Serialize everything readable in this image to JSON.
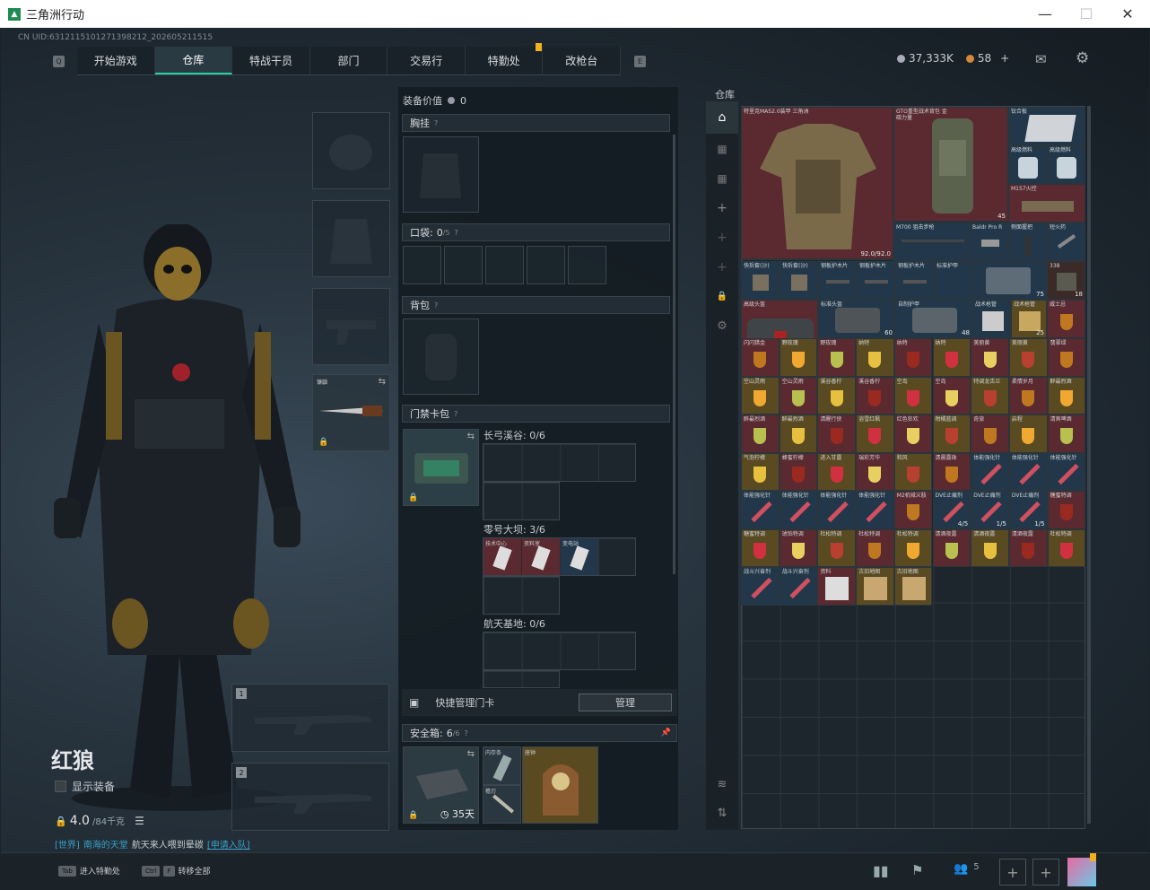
{
  "window": {
    "title": "三角洲行动",
    "logo": "triangle-logo-icon"
  },
  "uid": "CN UID:6312115101271398212_202605211515",
  "nav": {
    "tabs": [
      {
        "label": "开始游戏"
      },
      {
        "label": "仓库",
        "active": true
      },
      {
        "label": "特战干员"
      },
      {
        "label": "部门"
      },
      {
        "label": "交易行"
      },
      {
        "label": "特勤处"
      },
      {
        "label": "改枪台"
      }
    ]
  },
  "currency": {
    "coins": "37,333K",
    "tickets": "58",
    "plus": "+"
  },
  "operator": {
    "name": "红狼",
    "show_equipment": "显示装备",
    "weight": "4.0",
    "weight_max": "/84千克"
  },
  "chat": {
    "channel": "[世界]",
    "user": "南海的天堂",
    "msg": "航天来人喂到晕碳",
    "link": "[申请入队]"
  },
  "melee": {
    "label": "镰鼬"
  },
  "weapon_slots": [
    "1",
    "2"
  ],
  "equip": {
    "value_label": "装备价值",
    "value": "0",
    "chest_rig": "胸挂",
    "pockets": "口袋:",
    "pockets_count": "0",
    "pockets_max": "/5",
    "backpack": "背包",
    "keycard": "门禁卡包",
    "key_groups": [
      {
        "label": "长弓溪谷: 0/6"
      },
      {
        "label": "零号大坝: 3/6"
      },
      {
        "label": "航天基地: 0/6"
      }
    ],
    "dam_keys": [
      "技术中心",
      "资料室",
      "变电站"
    ],
    "quick_manage": "快捷管理门卡",
    "manage_btn": "管理",
    "safe_box": "安全箱:",
    "safe_box_count": "6",
    "safe_box_max": "/6",
    "safe_days": "35天",
    "safe_items": [
      "内存条",
      "檐刃",
      "座钟"
    ]
  },
  "stash": {
    "title": "仓库",
    "items": [
      {
        "name": "特里克MAS2.0装甲 三角洲"
      },
      {
        "name": "GTO重型战术背包 金碳力量",
        "count": "45"
      },
      {
        "name": "钛合板"
      },
      {
        "name": "高级燃料"
      },
      {
        "name": "高级燃料"
      },
      {
        "name": "M157火控"
      },
      {
        "name": "92.0/92.0"
      },
      {
        "name": "M700 狙击步枪"
      },
      {
        "name": "Baldr Pro R"
      },
      {
        "name": "侧面握把"
      },
      {
        "name": "短火药"
      },
      {
        "name": "快拆套(沙)"
      },
      {
        "name": "快拆套(沙)"
      },
      {
        "name": "钢板护木片"
      },
      {
        "name": "钢板护木片"
      },
      {
        "name": "钢板护木片"
      },
      {
        "name": "标准护甲"
      },
      {
        "name": "75"
      },
      {
        "name": "338",
        "count": "18"
      },
      {
        "name": "高级头盔",
        "count": "100"
      },
      {
        "name": "标准头盔",
        "count": "60"
      },
      {
        "name": "自制护甲",
        "count": "48"
      },
      {
        "name": "战术枪管"
      },
      {
        "name": "战术枪管",
        "count": "25"
      },
      {
        "name": "威士忌"
      }
    ],
    "drink_labels": [
      "闪闪猎金",
      "野玫瑰",
      "野玫瑰",
      "纳特",
      "纳特",
      "纳特",
      "美丽黄",
      "美丽黄",
      "翡翠绿",
      "空山灵雨",
      "空山灵雨",
      "溪谷香柠",
      "溪谷香柠",
      "空岛",
      "空岛",
      "特调龙舌兰",
      "柔情岁月",
      "醉最烈酒",
      "醉最烈酒",
      "醉最烈酒",
      "清醒行侠",
      "浴雪红枫",
      "红色狂欢",
      "柑橘蓝调",
      "奇旅",
      "启程",
      "清爽啤酒",
      "气泡柠檬",
      "蜂蜜柠檬",
      "进入甘露",
      "瑞彩芳华",
      "和风",
      "清晨露珠",
      "体能强化针",
      "体能强化针",
      "体能强化针",
      "体能强化针",
      "体能强化针",
      "体能强化针",
      "体能强化针",
      "M2机械义肢",
      "DVE止痛剂",
      "DVE止痛剂",
      "DVE止痛剂",
      "糖蜜特调",
      "糖蜜特调",
      "琥珀特调",
      "杜松特调",
      "杜松特调",
      "杜松特调",
      "清酒夜露",
      "清酒夜露",
      "清酒夜露",
      "杜松特调",
      "战斗兴奋剂",
      "战斗兴奋剂",
      "资料",
      "古旧地图",
      "古旧地图"
    ],
    "drink_counts": {
      "dve1": "4/5",
      "dve2": "1/5",
      "dve3": "1/5"
    }
  },
  "bottom": {
    "tab_key": "Tab",
    "tab_label": "进入特勤处",
    "ctrl_key": "Ctrl",
    "f_key": "F",
    "ctrl_label": "转移全部",
    "party_count": "5"
  },
  "colors": {
    "accent": "#28d1a0",
    "red_item": "#5a2a30",
    "gold_item": "#5a4a22",
    "blue_item": "#22384a"
  }
}
